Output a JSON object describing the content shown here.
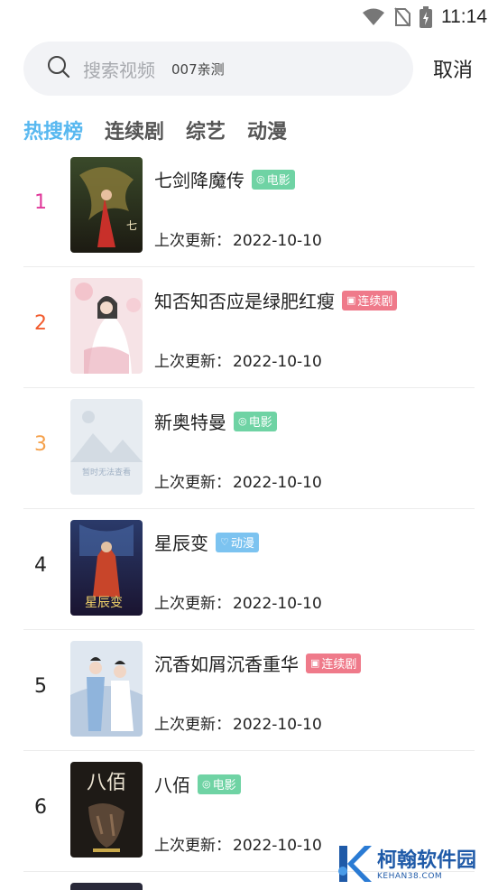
{
  "status_bar": {
    "time": "11:14"
  },
  "search": {
    "placeholder": "搜索视频",
    "hint": "007亲测",
    "cancel_label": "取消"
  },
  "tabs": [
    {
      "label": "热搜榜",
      "active": true
    },
    {
      "label": "连续剧",
      "active": false
    },
    {
      "label": "综艺",
      "active": false
    },
    {
      "label": "动漫",
      "active": false
    }
  ],
  "update_prefix": "上次更新：",
  "items": [
    {
      "rank": "1",
      "rank_color": "#e0399a",
      "title": "七剑降魔传",
      "tag": "电影",
      "tag_color": "#6fd3a4",
      "tag_icon": "film-icon",
      "date": "2022-10-10"
    },
    {
      "rank": "2",
      "rank_color": "#f25b2d",
      "title": "知否知否应是绿肥红瘦",
      "tag": "连续剧",
      "tag_color": "#ef7a8a",
      "tag_icon": "tv-icon",
      "date": "2022-10-10"
    },
    {
      "rank": "3",
      "rank_color": "#f5a04a",
      "title": "新奥特曼",
      "tag": "电影",
      "tag_color": "#6fd3a4",
      "tag_icon": "film-icon",
      "date": "2022-10-10",
      "poster_placeholder": "暂时无法查看"
    },
    {
      "rank": "4",
      "rank_color": "#222222",
      "title": "星辰变",
      "tag": "动漫",
      "tag_color": "#7cc3f0",
      "tag_icon": "heart-icon",
      "date": "2022-10-10"
    },
    {
      "rank": "5",
      "rank_color": "#222222",
      "title": "沉香如屑沉香重华",
      "tag": "连续剧",
      "tag_color": "#ef7a8a",
      "tag_icon": "tv-icon",
      "date": "2022-10-10"
    },
    {
      "rank": "6",
      "rank_color": "#222222",
      "title": "八佰",
      "tag": "电影",
      "tag_color": "#6fd3a4",
      "tag_icon": "film-icon",
      "date": "2022-10-10"
    }
  ],
  "watermark": {
    "name": "柯翰软件园",
    "domain": "KEHAN38.COM"
  },
  "colors": {
    "accent": "#58b8f0"
  }
}
